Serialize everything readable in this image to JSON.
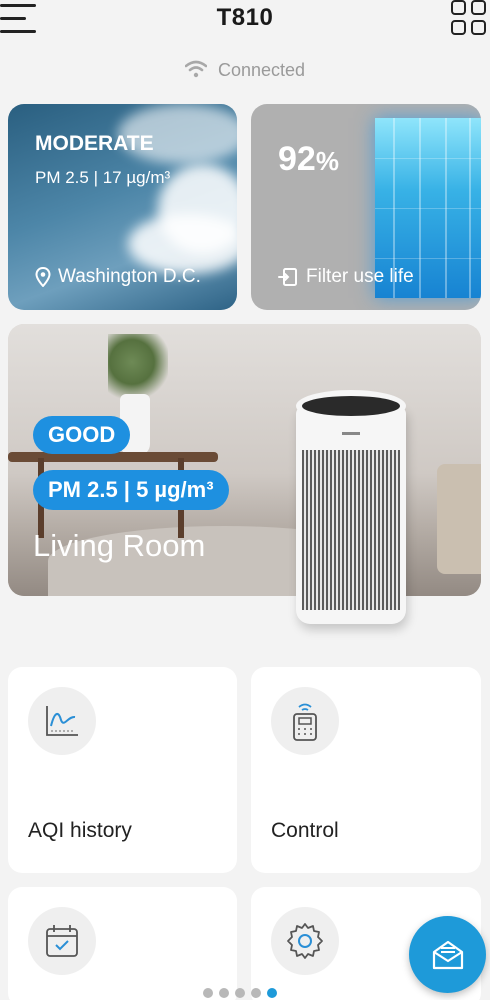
{
  "header": {
    "title": "T810"
  },
  "status": {
    "connection": "Connected"
  },
  "outdoor": {
    "level": "MODERATE",
    "pm": "PM 2.5 | 17 µg/m³",
    "location": "Washington D.C."
  },
  "filter": {
    "percent": "92",
    "percent_sign": "%",
    "label": "Filter use life",
    "life_fraction": 0.92
  },
  "room": {
    "level": "GOOD",
    "pm": "PM 2.5 | 5 µg/m³",
    "name": "Living Room"
  },
  "tiles": [
    {
      "label": "AQI history",
      "icon": "chart-icon"
    },
    {
      "label": "Control",
      "icon": "remote-icon"
    },
    {
      "label": "",
      "icon": "calendar-icon"
    },
    {
      "label": "",
      "icon": "gear-icon"
    }
  ],
  "fab": {
    "icon": "message-icon"
  },
  "pager": {
    "count": 5,
    "active": 5
  },
  "colors": {
    "accent": "#1e9ad9",
    "badge": "#1e90e0"
  }
}
